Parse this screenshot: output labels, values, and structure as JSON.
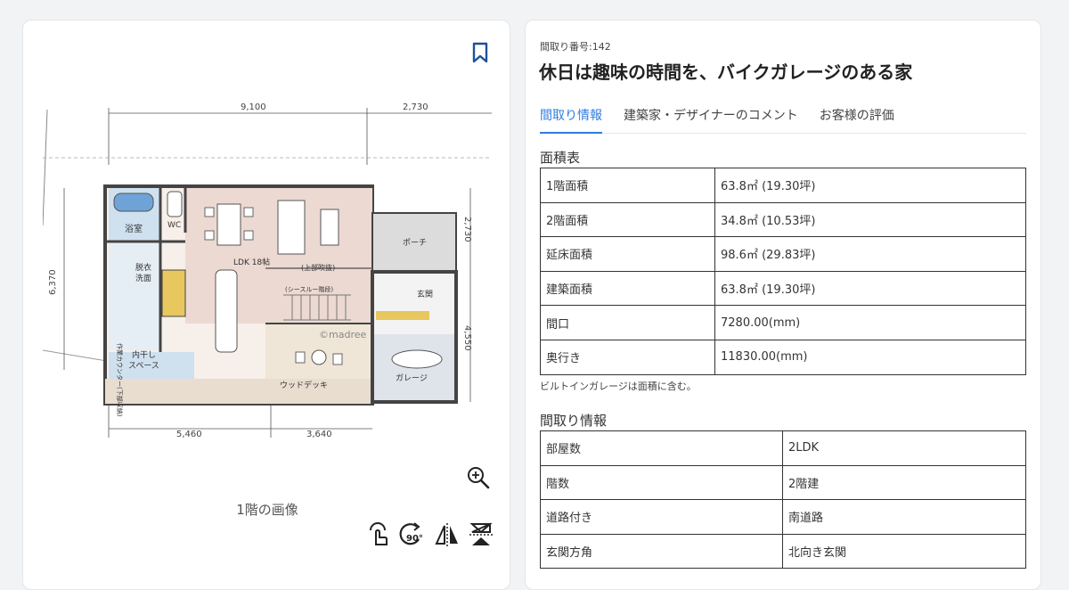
{
  "left": {
    "floor_caption": "1階の画像",
    "icons": {
      "bookmark": "bookmark-icon",
      "zoom": "zoom-in-icon",
      "tools": [
        "pan-hand-icon",
        "rotate-90-icon",
        "flip-horizontal-icon",
        "flip-vertical-icon"
      ],
      "rotate_label": "90°"
    },
    "plan": {
      "dims_top": [
        "9,100",
        "2,730"
      ],
      "dims_bottom": [
        "5,460",
        "3,640"
      ],
      "dims_left": "6,370",
      "dims_right": [
        "2,730",
        "4,550"
      ],
      "rooms": {
        "bath": "浴室",
        "wc": "WC",
        "ldk": "LDK 18帖",
        "fukinuke": "(上部吹抜)",
        "porch": "ポーチ",
        "datsui": [
          "脱衣",
          "洗面"
        ],
        "stair": "(シースルー階段)",
        "genkan": "玄関",
        "counter": "作業カウンター(下部収納)",
        "hoshi": [
          "内干し",
          "スペース"
        ],
        "deck": "ウッドデッキ",
        "garage": "ガレージ",
        "watermark": "©madree"
      }
    }
  },
  "right": {
    "plan_no": "間取り番号:142",
    "title": "休日は趣味の時間を、バイクガレージのある家",
    "tabs": [
      "間取り情報",
      "建築家・デザイナーのコメント",
      "お客様の評価"
    ],
    "area_title": "面積表",
    "area_rows": [
      [
        "1階面積",
        "63.8㎡ (19.30坪)"
      ],
      [
        "2階面積",
        "34.8㎡ (10.53坪)"
      ],
      [
        "延床面積",
        "98.6㎡ (29.83坪)"
      ],
      [
        "建築面積",
        "63.8㎡ (19.30坪)"
      ],
      [
        "間口",
        "7280.00(mm)"
      ],
      [
        "奥行き",
        "11830.00(mm)"
      ]
    ],
    "area_note": "ビルトインガレージは面積に含む。",
    "info_title": "間取り情報",
    "info_rows": [
      [
        "部屋数",
        "2LDK"
      ],
      [
        "階数",
        "2階建"
      ],
      [
        "道路付き",
        "南道路"
      ],
      [
        "玄関方角",
        "北向き玄関"
      ]
    ]
  },
  "colors": {
    "accent": "#2f7de1",
    "bookmark": "#1f4f9e",
    "ldk_floor": "#ecd9d2",
    "bath_floor": "#cfe0ef",
    "deck": "#e9ddd0",
    "porch": "#dcdcdc",
    "wood": "#e8c75f"
  }
}
